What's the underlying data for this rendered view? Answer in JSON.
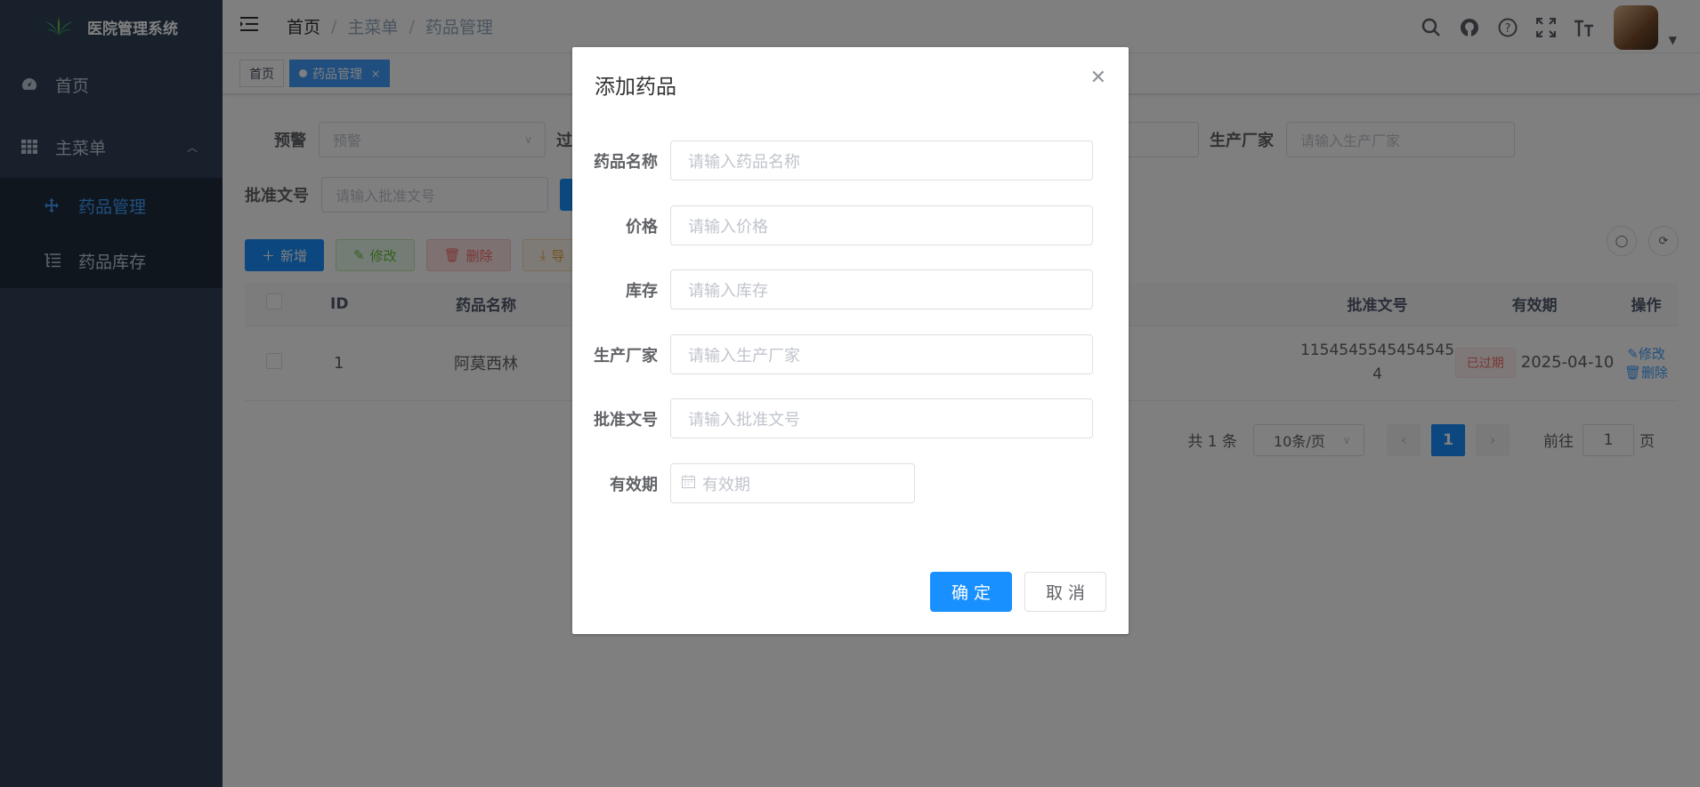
{
  "app": {
    "title": "医院管理系统"
  },
  "sidebar": {
    "items": [
      {
        "label": "首页",
        "icon": "dashboard-icon"
      },
      {
        "label": "主菜单",
        "icon": "table-icon"
      }
    ],
    "submenu": [
      {
        "label": "药品管理",
        "icon": "move-icon",
        "active": true
      },
      {
        "label": "药品库存",
        "icon": "tree-table-icon"
      }
    ]
  },
  "navbar": {
    "breadcrumb": [
      "首页",
      "主菜单",
      "药品管理"
    ],
    "sep": "/"
  },
  "tags": [
    {
      "label": "首页"
    },
    {
      "label": "药品管理",
      "close": "×"
    }
  ],
  "search": {
    "warning_label": "预警",
    "warning_placeholder": "预警",
    "expiry_label": "过",
    "manufacturer_label": "生产厂家",
    "manufacturer_placeholder": "请输入生产厂家",
    "approval_label": "批准文号",
    "approval_placeholder": "请输入批准文号"
  },
  "toolbar": {
    "add": "新增",
    "edit": "修改",
    "delete": "删除",
    "export": "导"
  },
  "table": {
    "headers": {
      "id": "ID",
      "name": "药品名称",
      "approval": "批准文号",
      "expiry": "有效期",
      "ops": "操作"
    },
    "rows": [
      {
        "id": "1",
        "name": "阿莫西林",
        "approval_line1": "1154545545454545",
        "approval_line2": "4",
        "status": "已过期",
        "expiry": "2025-04-10",
        "edit": "修改",
        "delete": "删除"
      }
    ]
  },
  "pagination": {
    "total": "共 1 条",
    "size": "10条/页",
    "current": "1",
    "goto_label": "前往",
    "goto_value": "1",
    "page_unit": "页"
  },
  "dialog": {
    "title": "添加药品",
    "fields": [
      {
        "label": "药品名称",
        "placeholder": "请输入药品名称"
      },
      {
        "label": "价格",
        "placeholder": "请输入价格"
      },
      {
        "label": "库存",
        "placeholder": "请输入库存"
      },
      {
        "label": "生产厂家",
        "placeholder": "请输入生产厂家"
      },
      {
        "label": "批准文号",
        "placeholder": "请输入批准文号"
      },
      {
        "label": "有效期",
        "placeholder": "有效期"
      }
    ],
    "confirm": "确 定",
    "cancel": "取 消"
  },
  "colors": {
    "primary": "#1890ff",
    "sidebar": "#304156",
    "danger": "#f56c6c"
  }
}
